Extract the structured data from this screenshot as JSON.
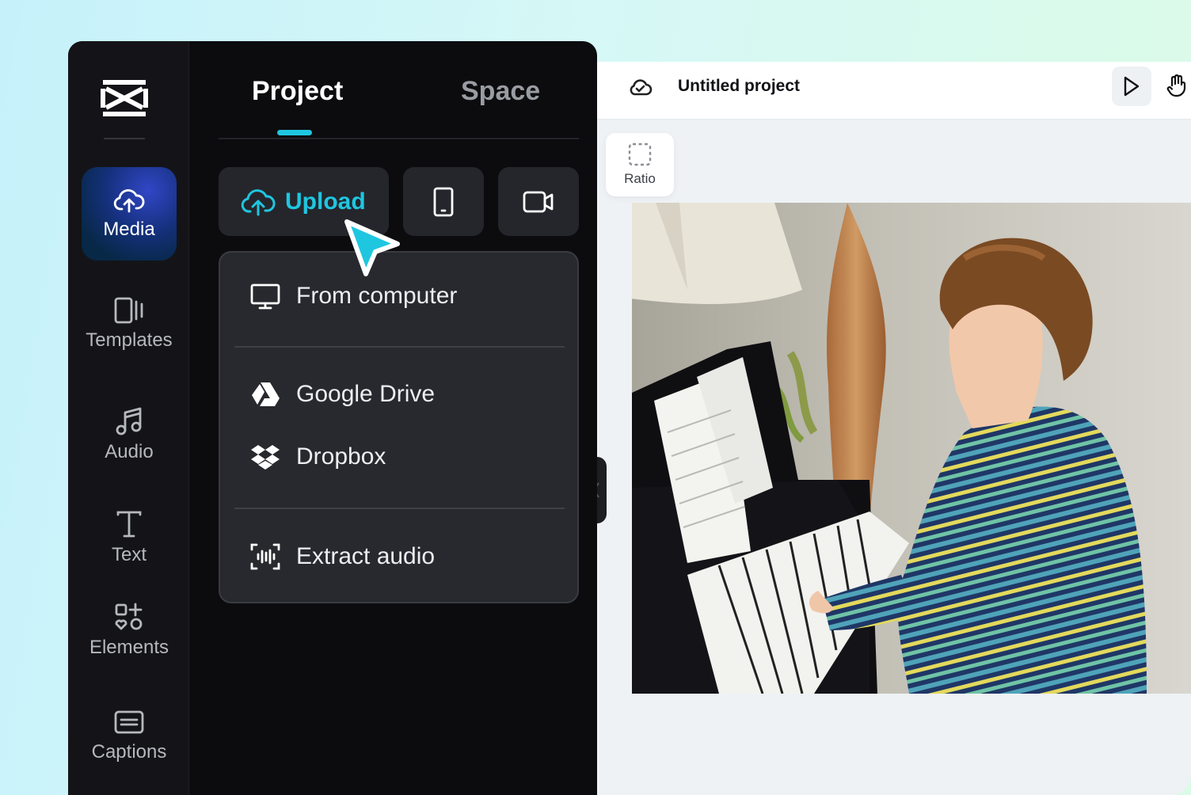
{
  "brand": {
    "accent": "#1fc6e0",
    "panel_bg": "#0c0c0f"
  },
  "sidebar": {
    "logo": "capcut-logo-icon",
    "items": [
      {
        "label": "Media",
        "icon": "cloud-upload-icon",
        "active": true
      },
      {
        "label": "Templates",
        "icon": "templates-icon"
      },
      {
        "label": "Audio",
        "icon": "music-note-icon"
      },
      {
        "label": "Text",
        "icon": "text-icon"
      },
      {
        "label": "Elements",
        "icon": "elements-icon"
      },
      {
        "label": "Captions",
        "icon": "captions-icon"
      }
    ]
  },
  "tabs": {
    "project": "Project",
    "space": "Space",
    "active": "Project"
  },
  "upload": {
    "label": "Upload",
    "icon": "cloud-upload-icon"
  },
  "quick_buttons": [
    "phone-icon",
    "camera-icon"
  ],
  "upload_menu": {
    "items": [
      {
        "label": "From computer",
        "icon": "monitor-icon"
      },
      {
        "label": "Google Drive",
        "icon": "google-drive-icon"
      },
      {
        "label": "Dropbox",
        "icon": "dropbox-icon"
      },
      {
        "label": "Extract audio",
        "icon": "extract-audio-icon"
      }
    ]
  },
  "editor": {
    "title": "Untitled project",
    "ratio_label": "Ratio",
    "tools": [
      "select-pointer-icon",
      "hand-icon"
    ],
    "canvas_image": "Boy in striped sweater playing an upright piano"
  }
}
